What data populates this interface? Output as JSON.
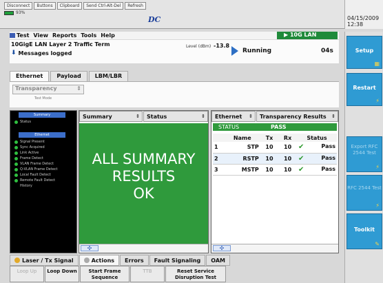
{
  "topbar": {
    "buttons": [
      "Disconnect",
      "Buttons",
      "Clipboard",
      "Send Ctrl-Alt-Del",
      "Refresh"
    ],
    "battery": "93%",
    "logo": "DC",
    "date": "04/15/2009",
    "time": "12:38"
  },
  "menu": {
    "items": [
      "Test",
      "View",
      "Reports",
      "Tools",
      "Help"
    ],
    "badge": "10G LAN"
  },
  "status": {
    "title": "10GigE LAN Layer 2 Traffic Term",
    "messages": "Messages logged",
    "level_label": "Level (dBm)",
    "level_value": "-13.8",
    "run_label": "Running",
    "run_time": "04s"
  },
  "tabs": [
    "Ethernet",
    "Payload",
    "LBM/LBR"
  ],
  "tabpanel": {
    "select": "Transparency",
    "sub": "Test Mode"
  },
  "leftpanel": {
    "head1": "Summary",
    "status_row": "Status",
    "head2": "Ethernet",
    "rows": [
      "Signal Present",
      "Sync Acquired",
      "Link Active",
      "Frame Detect",
      "VLAN Frame Detect",
      "Q-VLAN Frame Detect",
      "Local Fault Detect",
      "Remote Fault Detect",
      "History"
    ]
  },
  "summary": {
    "sel1": "Summary",
    "sel2": "Status",
    "line1": "ALL SUMMARY",
    "line2": "RESULTS",
    "line3": "OK"
  },
  "results": {
    "sel1": "Ethernet",
    "sel2": "Transparency Results",
    "status_label": "STATUS",
    "status_value": "PASS",
    "headers": [
      "Name",
      "Tx",
      "Rx",
      "Status"
    ],
    "rows": [
      {
        "idx": "1",
        "name": "STP",
        "tx": "10",
        "rx": "10",
        "status": "Pass"
      },
      {
        "idx": "2",
        "name": "RSTP",
        "tx": "10",
        "rx": "10",
        "status": "Pass"
      },
      {
        "idx": "3",
        "name": "MSTP",
        "tx": "10",
        "rx": "10",
        "status": "Pass"
      }
    ]
  },
  "bottom": {
    "tabs": [
      "Laser / Tx Signal",
      "Actions",
      "Errors",
      "Fault Signaling",
      "OAM"
    ],
    "buttons": [
      "Loop Up",
      "Loop Down",
      "Start Frame Sequence",
      "TTB",
      "Reset Service Disruption Test"
    ]
  },
  "right": {
    "setup": "Setup",
    "restart": "Restart",
    "export": "Export RFC 2544 Test",
    "rfc": "RFC 2544 Test",
    "toolkit": "Toolkit"
  }
}
